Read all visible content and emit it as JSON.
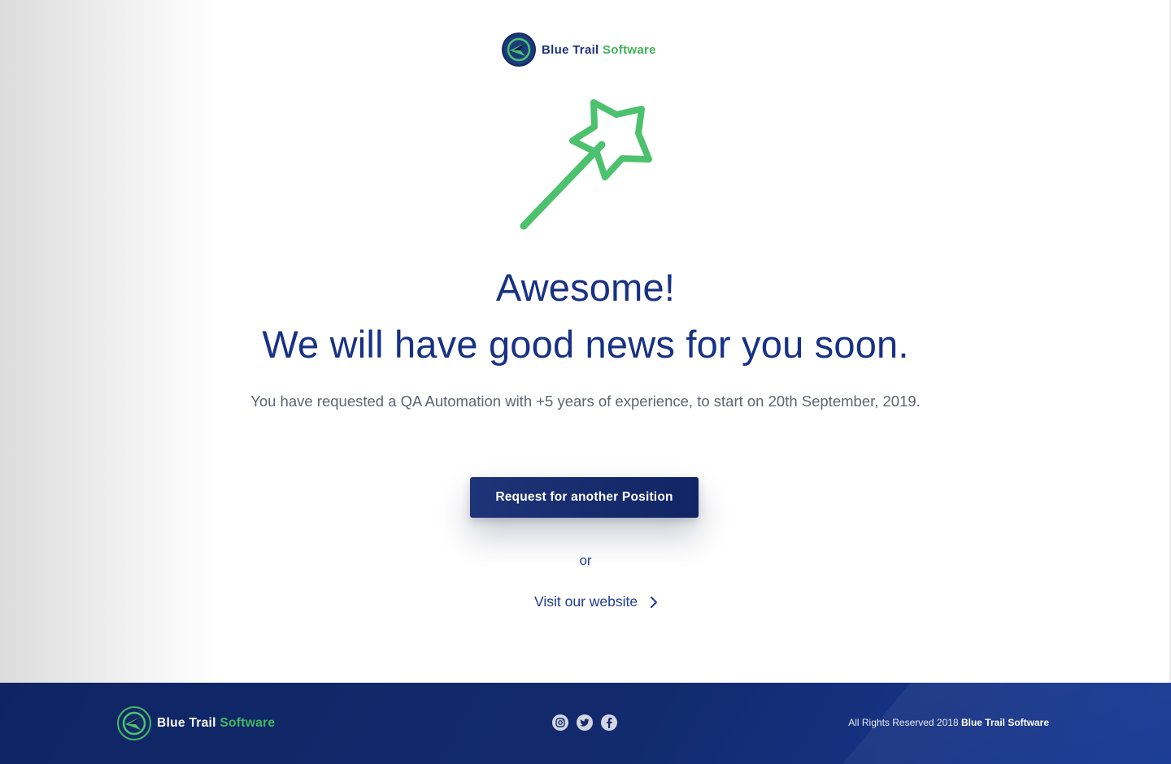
{
  "header": {
    "logo_word_a": "Blue Trail",
    "logo_word_b": "Software"
  },
  "hero": {
    "icon": "magic-wand-icon",
    "title_line1": "Awesome!",
    "title_line2": "We will have good news for you soon.",
    "subtitle": "You have requested a QA Automation with +5 years of experience, to start on 20th September, 2019."
  },
  "actions": {
    "primary_button": "Request for another Position",
    "or_text": "or",
    "visit_link": "Visit our website"
  },
  "footer": {
    "logo_word_a": "Blue Trail",
    "logo_word_b": "Software",
    "socials": [
      "instagram-icon",
      "twitter-icon",
      "facebook-icon"
    ],
    "copyright_prefix": "All Rights Reserved 2018",
    "copyright_brand": "Blue Trail Software"
  },
  "colors": {
    "brand_navy": "#173184",
    "brand_green": "#4cc16e",
    "button_navy": "#112564",
    "footer_navy": "#0f2563"
  }
}
